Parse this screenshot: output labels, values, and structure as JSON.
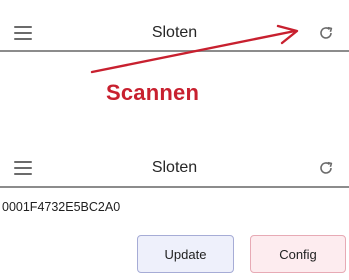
{
  "top_bar": {
    "title": "Sloten",
    "menu_icon": "hamburger-menu-icon",
    "refresh_icon": "refresh-icon"
  },
  "annotation": {
    "label": "Scannen",
    "color": "#c8202f"
  },
  "bottom_bar": {
    "title": "Sloten",
    "menu_icon": "hamburger-menu-icon",
    "refresh_icon": "refresh-icon"
  },
  "device": {
    "id": "0001F4732E5BC2A0"
  },
  "buttons": {
    "update_label": "Update",
    "config_label": "Config"
  }
}
